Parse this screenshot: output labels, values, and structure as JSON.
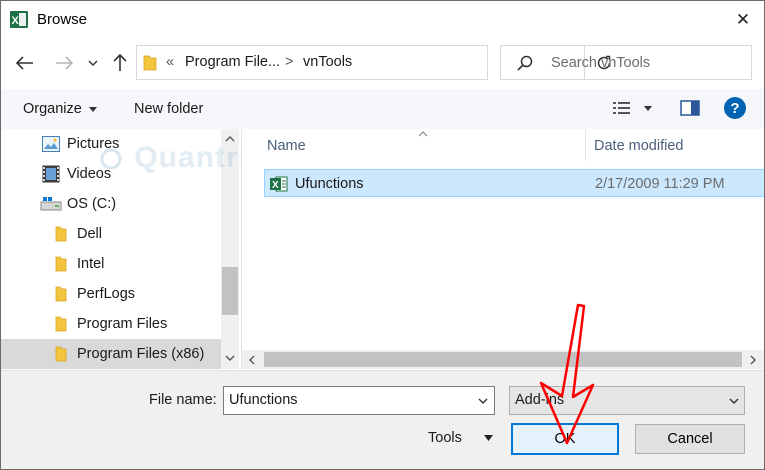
{
  "window": {
    "title": "Browse",
    "close_glyph": "✕"
  },
  "nav": {
    "address": {
      "overflow": "«",
      "segments": [
        "Program File...",
        "vnTools"
      ],
      "separator": ">"
    },
    "search_placeholder": "Search vnTools"
  },
  "toolbar": {
    "organize": "Organize",
    "new_folder": "New folder",
    "help": "?"
  },
  "nav_pane": {
    "items": [
      {
        "label": "Pictures",
        "icon": "pictures-icon"
      },
      {
        "label": "Videos",
        "icon": "videos-icon"
      },
      {
        "label": "OS (C:)",
        "icon": "drive-icon"
      },
      {
        "label": "Dell",
        "icon": "folder-icon"
      },
      {
        "label": "Intel",
        "icon": "folder-icon"
      },
      {
        "label": "PerfLogs",
        "icon": "folder-icon"
      },
      {
        "label": "Program Files",
        "icon": "folder-icon"
      },
      {
        "label": "Program Files (x86)",
        "icon": "folder-icon",
        "selected": true
      }
    ]
  },
  "file_list": {
    "columns": {
      "name": "Name",
      "date": "Date modified"
    },
    "rows": [
      {
        "name": "Ufunctions",
        "date": "2/17/2009 11:29 PM",
        "icon": "excel-addin-icon",
        "selected": true
      }
    ]
  },
  "bottom": {
    "file_name_label": "File name:",
    "file_name_value": "Ufunctions",
    "file_type_value": "Add-ins",
    "tools_label": "Tools",
    "ok_label": "OK",
    "cancel_label": "Cancel"
  },
  "watermark": "Quantrimang",
  "colors": {
    "accent": "#0078d7",
    "selection": "#cce8ff",
    "annotation_arrow": "#ff0000",
    "excel_green": "#1d7145"
  }
}
